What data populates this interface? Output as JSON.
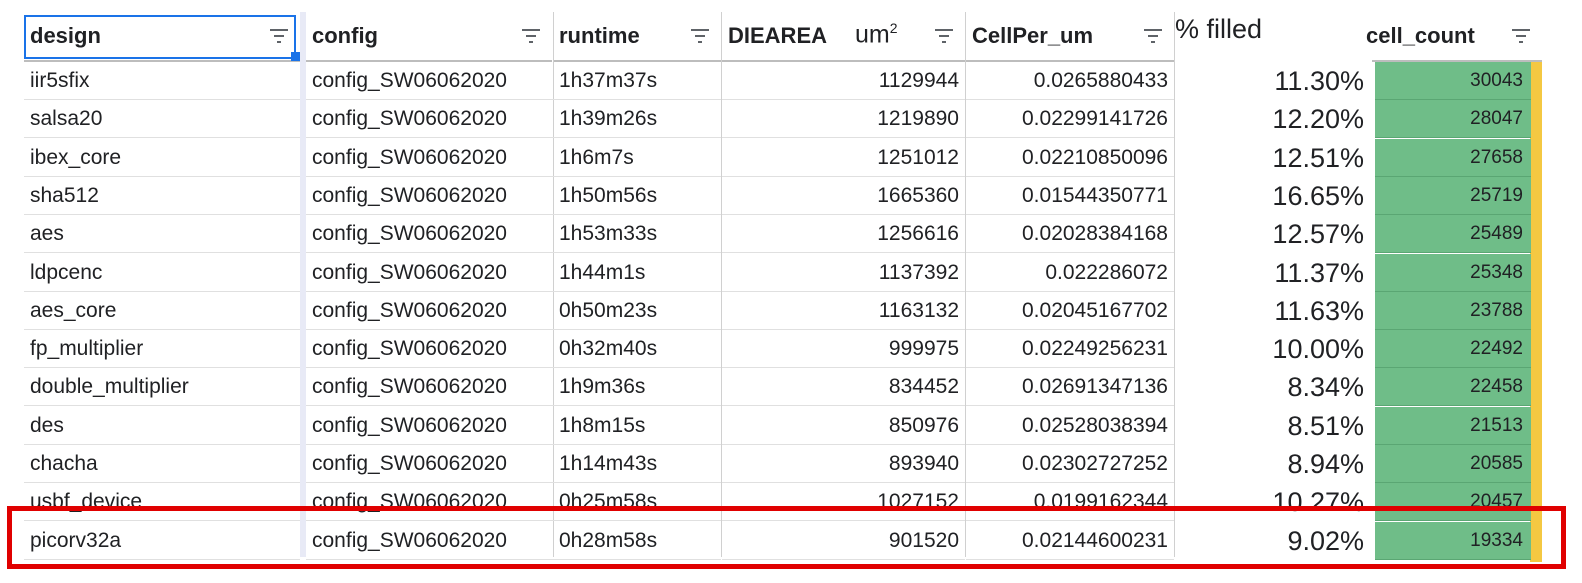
{
  "headers": {
    "design": "design",
    "config": "config",
    "runtime": "runtime",
    "diearea": "DIEAREA",
    "diearea_unit": "um",
    "diearea_unit_sup": "2",
    "cellper": "CellPer_um",
    "pct_filled": "% filled",
    "cell_count": "cell_count"
  },
  "rows": [
    {
      "design": "iir5sfix",
      "config": "config_SW06062020",
      "runtime": "1h37m37s",
      "diearea": "1129944",
      "cellper": "0.0265880433",
      "pct": "11.30%",
      "cells": "30043"
    },
    {
      "design": "salsa20",
      "config": "config_SW06062020",
      "runtime": "1h39m26s",
      "diearea": "1219890",
      "cellper": "0.02299141726",
      "pct": "12.20%",
      "cells": "28047"
    },
    {
      "design": "ibex_core",
      "config": "config_SW06062020",
      "runtime": "1h6m7s",
      "diearea": "1251012",
      "cellper": "0.02210850096",
      "pct": "12.51%",
      "cells": "27658"
    },
    {
      "design": "sha512",
      "config": "config_SW06062020",
      "runtime": "1h50m56s",
      "diearea": "1665360",
      "cellper": "0.01544350771",
      "pct": "16.65%",
      "cells": "25719"
    },
    {
      "design": "aes",
      "config": "config_SW06062020",
      "runtime": "1h53m33s",
      "diearea": "1256616",
      "cellper": "0.02028384168",
      "pct": "12.57%",
      "cells": "25489"
    },
    {
      "design": "ldpcenc",
      "config": "config_SW06062020",
      "runtime": "1h44m1s",
      "diearea": "1137392",
      "cellper": "0.022286072",
      "pct": "11.37%",
      "cells": "25348"
    },
    {
      "design": "aes_core",
      "config": "config_SW06062020",
      "runtime": "0h50m23s",
      "diearea": "1163132",
      "cellper": "0.02045167702",
      "pct": "11.63%",
      "cells": "23788"
    },
    {
      "design": "fp_multiplier",
      "config": "config_SW06062020",
      "runtime": "0h32m40s",
      "diearea": "999975",
      "cellper": "0.02249256231",
      "pct": "10.00%",
      "cells": "22492"
    },
    {
      "design": "double_multiplier",
      "config": "config_SW06062020",
      "runtime": "1h9m36s",
      "diearea": "834452",
      "cellper": "0.02691347136",
      "pct": "8.34%",
      "cells": "22458"
    },
    {
      "design": "des",
      "config": "config_SW06062020",
      "runtime": "1h8m15s",
      "diearea": "850976",
      "cellper": "0.02528038394",
      "pct": "8.51%",
      "cells": "21513"
    },
    {
      "design": "chacha",
      "config": "config_SW06062020",
      "runtime": "1h14m43s",
      "diearea": "893940",
      "cellper": "0.02302727252",
      "pct": "8.94%",
      "cells": "20585"
    },
    {
      "design": "usbf_device",
      "config": "config_SW06062020",
      "runtime": "0h25m58s",
      "diearea": "1027152",
      "cellper": "0.0199162344",
      "pct": "10.27%",
      "cells": "20457"
    },
    {
      "design": "picorv32a",
      "config": "config_SW06062020",
      "runtime": "0h28m58s",
      "diearea": "901520",
      "cellper": "0.02144600231",
      "pct": "9.02%",
      "cells": "19334"
    }
  ],
  "colors": {
    "cell_count_fill": "#6fbd88",
    "highlight_box": "#e00000",
    "selection": "#1a73e8"
  },
  "icons": {
    "filter": "filter-icon"
  }
}
